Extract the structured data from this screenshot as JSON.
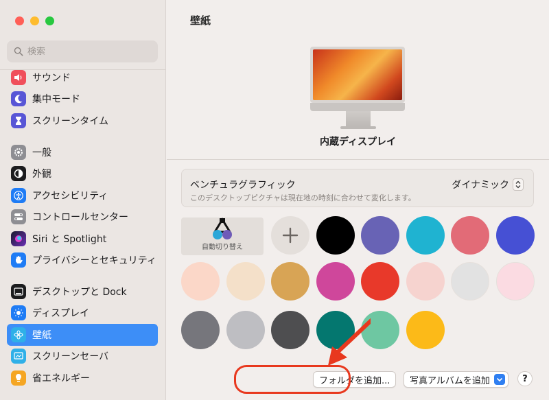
{
  "window": {
    "traffic_lights": [
      "close",
      "minimize",
      "zoom"
    ]
  },
  "sidebar": {
    "search": {
      "placeholder": "検索",
      "value": ""
    },
    "groups": [
      {
        "items": [
          {
            "label": "サウンド",
            "icon": "speaker-icon",
            "color": "#f04f5b"
          },
          {
            "label": "集中モード",
            "icon": "moon-icon",
            "color": "#5856d6"
          },
          {
            "label": "スクリーンタイム",
            "icon": "hourglass-icon",
            "color": "#5856d6"
          }
        ]
      },
      {
        "items": [
          {
            "label": "一般",
            "icon": "gear-icon",
            "color": "#8e8e93"
          },
          {
            "label": "外観",
            "icon": "appearance-icon",
            "color": "#1c1c1e"
          },
          {
            "label": "アクセシビリティ",
            "icon": "accessibility-icon",
            "color": "#1f7cf5"
          },
          {
            "label": "コントロールセンター",
            "icon": "toggles-icon",
            "color": "#8e8e93"
          },
          {
            "label": "Siri と Spotlight",
            "icon": "siri-icon",
            "color": "#c23bd4"
          },
          {
            "label": "プライバシーとセキュリティ",
            "icon": "hand-icon",
            "color": "#1f7cf5"
          }
        ]
      },
      {
        "items": [
          {
            "label": "デスクトップと Dock",
            "icon": "dock-icon",
            "color": "#1c1c1e"
          },
          {
            "label": "ディスプレイ",
            "icon": "sun-icon",
            "color": "#1f7cf5"
          },
          {
            "label": "壁紙",
            "icon": "flower-icon",
            "color": "#2fb0e8",
            "selected": true
          },
          {
            "label": "スクリーンセーバ",
            "icon": "screensaver-icon",
            "color": "#2fb0e8"
          },
          {
            "label": "省エネルギー",
            "icon": "bulb-icon",
            "color": "#f5a623"
          }
        ]
      }
    ]
  },
  "main": {
    "title": "壁紙",
    "display_name": "内蔵ディスプレイ",
    "wallpaper": {
      "name": "ベンチュラグラフィック",
      "description": "このデスクトップピクチャは現在地の時刻に合わせて変化します。",
      "mode": "ダイナミック"
    },
    "auto_rotate_label": "自動切り替え",
    "swatches": [
      "#000000",
      "#6863b5",
      "#1fb3d1",
      "#e26b77",
      "#4650d4",
      "#fbd7c8",
      "#f4e0c9",
      "#d8a455",
      "#cf479b",
      "#e8392a",
      "#f6d3cf",
      "#e2e2e2",
      "#fbdbe2",
      "#76767c",
      "#bebec2",
      "#4e4e50",
      "#04776f",
      "#6ec7a2",
      "#fcba18"
    ],
    "buttons": {
      "add_folder": "フォルダを追加...",
      "add_album": "写真アルバムを追加",
      "help": "?"
    },
    "annotation_color": "#e8381e"
  }
}
